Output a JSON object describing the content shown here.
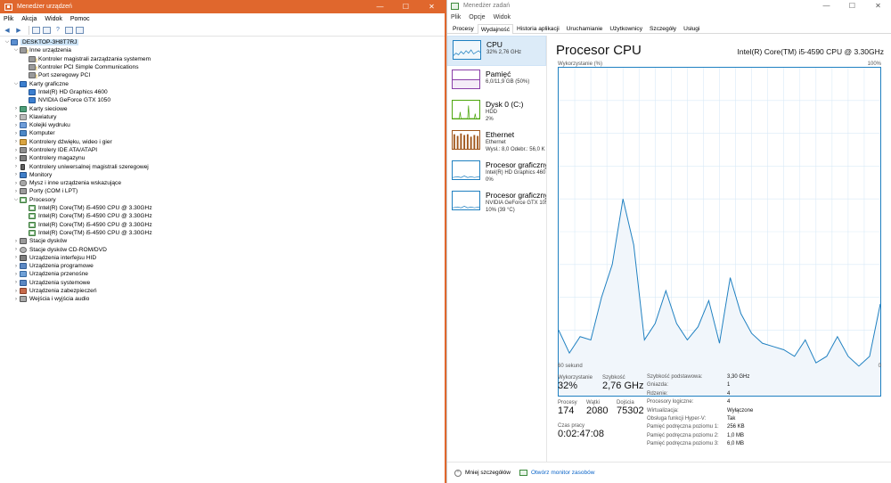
{
  "device_manager": {
    "title": "Menedżer urządzeń",
    "menu": [
      "Plik",
      "Akcja",
      "Widok",
      "Pomoc"
    ],
    "tree": [
      {
        "level": 0,
        "exp": "v",
        "icon": "computer-icon",
        "cls": "ic-pc",
        "label": "DESKTOP-3H8T7RJ",
        "root": true
      },
      {
        "level": 1,
        "exp": "v",
        "icon": "other-devices-icon",
        "cls": "ic-warn",
        "label": "Inne urządzenia"
      },
      {
        "level": 2,
        "exp": "",
        "icon": "unknown-device-icon",
        "cls": "ic-warn",
        "label": "Kontroler magistrali zarządzania systemem"
      },
      {
        "level": 2,
        "exp": "",
        "icon": "unknown-device-icon",
        "cls": "ic-warn",
        "label": "Kontroler PCI Simple Communications"
      },
      {
        "level": 2,
        "exp": "",
        "icon": "unknown-device-icon",
        "cls": "ic-warn",
        "label": "Port szeregowy PCI"
      },
      {
        "level": 1,
        "exp": "v",
        "icon": "display-adapter-icon",
        "cls": "ic-disp",
        "label": "Karty graficzne"
      },
      {
        "level": 2,
        "exp": "",
        "icon": "display-adapter-icon",
        "cls": "ic-disp",
        "label": "Intel(R) HD Graphics 4600"
      },
      {
        "level": 2,
        "exp": "",
        "icon": "display-adapter-icon",
        "cls": "ic-disp",
        "label": "NVIDIA GeForce GTX 1050"
      },
      {
        "level": 1,
        "exp": ">",
        "icon": "network-adapter-icon",
        "cls": "ic-net",
        "label": "Karty sieciowe"
      },
      {
        "level": 1,
        "exp": ">",
        "icon": "keyboard-icon",
        "cls": "ic-kbd",
        "label": "Klawiatury"
      },
      {
        "level": 1,
        "exp": ">",
        "icon": "print-queue-icon",
        "cls": "ic-queue",
        "label": "Kolejki wydruku"
      },
      {
        "level": 1,
        "exp": ">",
        "icon": "computer-icon",
        "cls": "ic-comp",
        "label": "Komputer"
      },
      {
        "level": 1,
        "exp": ">",
        "icon": "sound-controller-icon",
        "cls": "ic-snd",
        "label": "Kontrolery dźwięku, wideo i gier"
      },
      {
        "level": 1,
        "exp": ">",
        "icon": "ide-controller-icon",
        "cls": "ic-ide",
        "label": "Kontrolery IDE ATA/ATAPI"
      },
      {
        "level": 1,
        "exp": ">",
        "icon": "storage-controller-icon",
        "cls": "ic-stor",
        "label": "Kontrolery magazynu"
      },
      {
        "level": 1,
        "exp": ">",
        "icon": "usb-controller-icon",
        "cls": "ic-usb",
        "label": "Kontrolery uniwersalnej magistrali szeregowej"
      },
      {
        "level": 1,
        "exp": ">",
        "icon": "monitor-icon",
        "cls": "ic-mon",
        "label": "Monitory"
      },
      {
        "level": 1,
        "exp": ">",
        "icon": "mouse-icon",
        "cls": "ic-mouse",
        "label": "Mysz i inne urządzenia wskazujące"
      },
      {
        "level": 1,
        "exp": ">",
        "icon": "port-icon",
        "cls": "ic-port",
        "label": "Porty (COM i LPT)"
      },
      {
        "level": 1,
        "exp": "v",
        "icon": "processor-icon",
        "cls": "ic-cpu",
        "label": "Procesory"
      },
      {
        "level": 2,
        "exp": "",
        "icon": "processor-icon",
        "cls": "ic-cpu",
        "label": "Intel(R) Core(TM) i5-4590 CPU @ 3.30GHz"
      },
      {
        "level": 2,
        "exp": "",
        "icon": "processor-icon",
        "cls": "ic-cpu",
        "label": "Intel(R) Core(TM) i5-4590 CPU @ 3.30GHz"
      },
      {
        "level": 2,
        "exp": "",
        "icon": "processor-icon",
        "cls": "ic-cpu",
        "label": "Intel(R) Core(TM) i5-4590 CPU @ 3.30GHz"
      },
      {
        "level": 2,
        "exp": "",
        "icon": "processor-icon",
        "cls": "ic-cpu",
        "label": "Intel(R) Core(TM) i5-4590 CPU @ 3.30GHz"
      },
      {
        "level": 1,
        "exp": ">",
        "icon": "disk-drive-icon",
        "cls": "ic-disk",
        "label": "Stacje dysków"
      },
      {
        "level": 1,
        "exp": ">",
        "icon": "cd-rom-icon",
        "cls": "ic-cd",
        "label": "Stacje dysków CD-ROM/DVD"
      },
      {
        "level": 1,
        "exp": ">",
        "icon": "hid-icon",
        "cls": "ic-hid",
        "label": "Urządzenia interfejsu HID"
      },
      {
        "level": 1,
        "exp": ">",
        "icon": "software-device-icon",
        "cls": "ic-soft",
        "label": "Urządzenia programowe"
      },
      {
        "level": 1,
        "exp": ">",
        "icon": "portable-device-icon",
        "cls": "ic-portable",
        "label": "Urządzenia przenośne"
      },
      {
        "level": 1,
        "exp": ">",
        "icon": "system-device-icon",
        "cls": "ic-sys",
        "label": "Urządzenia systemowe"
      },
      {
        "level": 1,
        "exp": ">",
        "icon": "security-device-icon",
        "cls": "ic-sec",
        "label": "Urządzenia zabezpieczeń"
      },
      {
        "level": 1,
        "exp": ">",
        "icon": "audio-io-icon",
        "cls": "ic-audio",
        "label": "Wejścia i wyjścia audio"
      }
    ]
  },
  "task_manager": {
    "title": "Menedżer zadań",
    "menu": [
      "Plik",
      "Opcje",
      "Widok"
    ],
    "tabs": [
      "Procesy",
      "Wydajność",
      "Historia aplikacji",
      "Uruchamianie",
      "Użytkownicy",
      "Szczegóły",
      "Usługi"
    ],
    "active_tab": "Wydajność",
    "perf_items": [
      {
        "title": "CPU",
        "lines": [
          "32% 2,76 GHz"
        ],
        "kind": "cpu",
        "selected": true
      },
      {
        "title": "Pamięć",
        "lines": [
          "6,0/11,9 GB (50%)"
        ],
        "kind": "mem"
      },
      {
        "title": "Dysk 0 (C:)",
        "lines": [
          "HDD",
          "2%"
        ],
        "kind": "disk"
      },
      {
        "title": "Ethernet",
        "lines": [
          "Ethernet",
          "Wysł.: 8,0  Odebr.: 56,0 K"
        ],
        "kind": "eth"
      },
      {
        "title": "Procesor graficzny",
        "lines": [
          "Intel(R) HD Graphics 460",
          "0%"
        ],
        "kind": "gpu"
      },
      {
        "title": "Procesor graficzny",
        "lines": [
          "NVIDIA GeForce GTX 105",
          "10% (39 °C)"
        ],
        "kind": "gpu"
      }
    ],
    "cpu": {
      "heading": "Procesor CPU",
      "model": "Intel(R) Core(TM) i5-4590 CPU @ 3.30GHz",
      "graph_label": "Wykorzystanie (%)",
      "graph_max": "100%",
      "graph_time": "60 sekund",
      "graph_min": "0",
      "stats": {
        "util_label": "Wykorzystanie",
        "util": "32%",
        "speed_label": "Szybkość",
        "speed": "2,76 GHz",
        "proc_label": "Procesy",
        "proc": "174",
        "threads_label": "Wątki",
        "threads": "2080",
        "handles_label": "Dojścia",
        "handles": "75302",
        "uptime_label": "Czas pracy",
        "uptime": "0:02:47:08"
      },
      "props": [
        {
          "k": "Szybkość podstawowa:",
          "v": "3,30 GHz"
        },
        {
          "k": "Gniazda:",
          "v": "1"
        },
        {
          "k": "Rdzenie:",
          "v": "4"
        },
        {
          "k": "Procesory logiczne:",
          "v": "4"
        },
        {
          "k": "Wirtualizacja:",
          "v": "Wyłączone"
        },
        {
          "k": "Obsługa funkcji Hyper-V:",
          "v": "Tak"
        },
        {
          "k": "Pamięć podręczna poziomu 1:",
          "v": "256 KB"
        },
        {
          "k": "Pamięć podręczna poziomu 2:",
          "v": "1,0 MB"
        },
        {
          "k": "Pamięć podręczna poziomu 3:",
          "v": "6,0 MB"
        }
      ]
    },
    "footer": {
      "fewer": "Mniej szczegółów",
      "monitor": "Otwórz monitor zasobów"
    }
  },
  "chart_data": {
    "type": "area",
    "title": "Wykorzystanie (%)",
    "xlabel": "60 sekund",
    "ylim": [
      0,
      100
    ],
    "x": [
      60,
      58,
      56,
      54,
      52,
      50,
      48,
      46,
      44,
      42,
      40,
      38,
      36,
      34,
      32,
      30,
      28,
      26,
      24,
      22,
      20,
      18,
      16,
      14,
      12,
      10,
      8,
      6,
      4,
      2,
      0
    ],
    "values": [
      20,
      13,
      18,
      17,
      30,
      40,
      60,
      46,
      17,
      22,
      32,
      22,
      17,
      21,
      29,
      16,
      36,
      25,
      19,
      16,
      15,
      14,
      12,
      17,
      10,
      12,
      18,
      12,
      9,
      12,
      28
    ],
    "color": "#1f80c1"
  }
}
